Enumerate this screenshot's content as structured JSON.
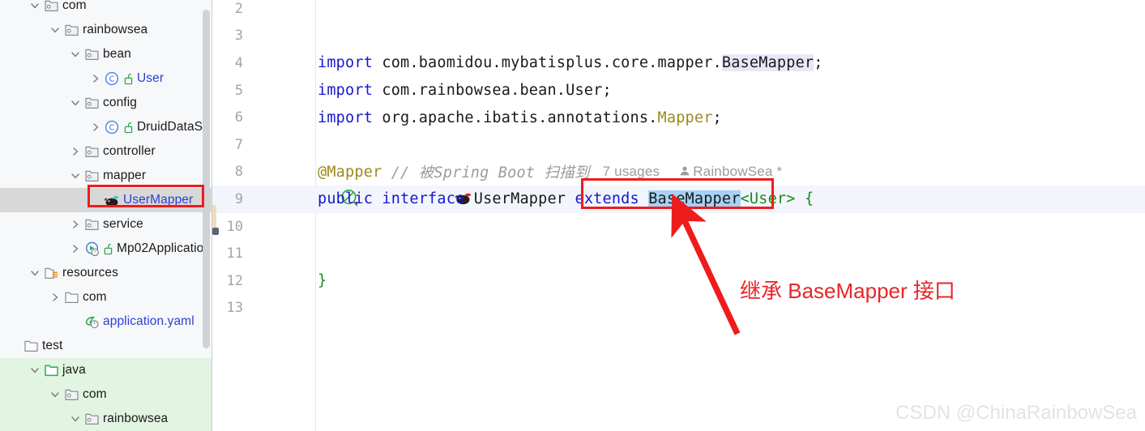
{
  "colors": {
    "accent_red": "#ee1c1c",
    "annotation_red": "#e8252a",
    "keyword_blue": "#1717cf",
    "annotation_olive": "#9c8a1e",
    "comment_gray": "#9b9b9b",
    "selection_blue": "#a6d2f5",
    "import_highlight": "#ebe6f7",
    "test_root_green": "#e2f4e2",
    "tree_selection_gray": "#d8d8d8"
  },
  "sidebar": {
    "items": [
      {
        "label": "com",
        "indent": 1,
        "twisty": "down",
        "icon": "package-icon",
        "vis": null,
        "style": "plain",
        "bg": "none"
      },
      {
        "label": "rainbowsea",
        "indent": 2,
        "twisty": "down",
        "icon": "package-icon",
        "vis": null,
        "style": "plain",
        "bg": "none"
      },
      {
        "label": "bean",
        "indent": 3,
        "twisty": "down",
        "icon": "package-icon",
        "vis": null,
        "style": "plain",
        "bg": "none"
      },
      {
        "label": "User",
        "indent": 4,
        "twisty": "right",
        "icon": "java-class-icon",
        "vis": "public-icon",
        "style": "blue",
        "bg": "none"
      },
      {
        "label": "config",
        "indent": 3,
        "twisty": "down",
        "icon": "package-icon",
        "vis": null,
        "style": "plain",
        "bg": "none"
      },
      {
        "label": "DruidDataSo",
        "indent": 4,
        "twisty": "right",
        "icon": "java-class-icon",
        "vis": "public-icon",
        "style": "plain",
        "bg": "none"
      },
      {
        "label": "controller",
        "indent": 3,
        "twisty": "right",
        "icon": "package-icon",
        "vis": null,
        "style": "plain",
        "bg": "none"
      },
      {
        "label": "mapper",
        "indent": 3,
        "twisty": "down",
        "icon": "package-icon",
        "vis": null,
        "style": "plain",
        "bg": "none"
      },
      {
        "label": "UserMapper",
        "indent": 4,
        "twisty": "none",
        "icon": "mybatis-icon",
        "vis": null,
        "style": "blue",
        "bg": "gray"
      },
      {
        "label": "service",
        "indent": 3,
        "twisty": "right",
        "icon": "package-icon",
        "vis": null,
        "style": "plain",
        "bg": "none"
      },
      {
        "label": "Mp02Applicatio",
        "indent": 3,
        "twisty": "right",
        "icon": "springboot-icon",
        "vis": "public-icon",
        "style": "plain",
        "bg": "none"
      },
      {
        "label": "resources",
        "indent": 1,
        "twisty": "down",
        "icon": "resources-icon",
        "vis": null,
        "style": "plain",
        "bg": "none"
      },
      {
        "label": "com",
        "indent": 2,
        "twisty": "right",
        "icon": "folder-icon",
        "vis": null,
        "style": "plain",
        "bg": "none"
      },
      {
        "label": "application.yaml",
        "indent": 3,
        "twisty": "none",
        "icon": "yaml-icon",
        "vis": null,
        "style": "blue",
        "bg": "none"
      },
      {
        "label": "test",
        "indent": 0,
        "twisty": "none",
        "icon": "folder-icon",
        "vis": null,
        "style": "plain",
        "bg": "none"
      },
      {
        "label": "java",
        "indent": 1,
        "twisty": "down",
        "icon": "source-root-icon",
        "vis": null,
        "style": "plain",
        "bg": "green"
      },
      {
        "label": "com",
        "indent": 2,
        "twisty": "down",
        "icon": "package-icon",
        "vis": null,
        "style": "plain",
        "bg": "green"
      },
      {
        "label": "rainbowsea",
        "indent": 3,
        "twisty": "down",
        "icon": "package-icon",
        "vis": null,
        "style": "plain",
        "bg": "green"
      }
    ]
  },
  "editor": {
    "lines": [
      {
        "num": "2",
        "current": false,
        "gutter_icons": []
      },
      {
        "num": "3",
        "current": false,
        "gutter_icons": []
      },
      {
        "num": "4",
        "current": false,
        "gutter_icons": []
      },
      {
        "num": "5",
        "current": false,
        "gutter_icons": []
      },
      {
        "num": "6",
        "current": false,
        "gutter_icons": []
      },
      {
        "num": "7",
        "current": false,
        "gutter_icons": []
      },
      {
        "num": "8",
        "current": false,
        "gutter_icons": []
      },
      {
        "num": "9",
        "current": true,
        "gutter_icons": [
          "not-implemented-icon",
          "mybatis-icon"
        ]
      },
      {
        "num": "10",
        "current": false,
        "gutter_icons": []
      },
      {
        "num": "11",
        "current": false,
        "gutter_icons": []
      },
      {
        "num": "12",
        "current": false,
        "gutter_icons": []
      },
      {
        "num": "13",
        "current": false,
        "gutter_icons": []
      }
    ],
    "code": {
      "l4_import": "import",
      "l4_path": " com.baomidou.mybatisplus.core.mapper.",
      "l4_type": "BaseMapper",
      "l4_semi": ";",
      "l5_import": "import",
      "l5_rest": " com.rainbowsea.bean.User;",
      "l6_import": "import",
      "l6_path": " org.apache.ibatis.annotations.",
      "l6_type": "Mapper",
      "l6_semi": ";",
      "l8_annotation": "@Mapper",
      "l8_comment": " // 被Spring Boot 扫描到",
      "l8_usages": "7 usages",
      "l8_author": "RainbowSea *",
      "l9_public": "public",
      "l9_interface": " interface ",
      "l9_name": "UserMapper",
      "l9_extends": " extends ",
      "l9_base": "BaseMapper",
      "l9_generic": "<User>",
      "l9_brace": " {",
      "l12_brace": "}"
    }
  },
  "annotation": {
    "text": "继承 BaseMapper 接口"
  },
  "watermark": {
    "text": "CSDN @ChinaRainbowSea"
  }
}
